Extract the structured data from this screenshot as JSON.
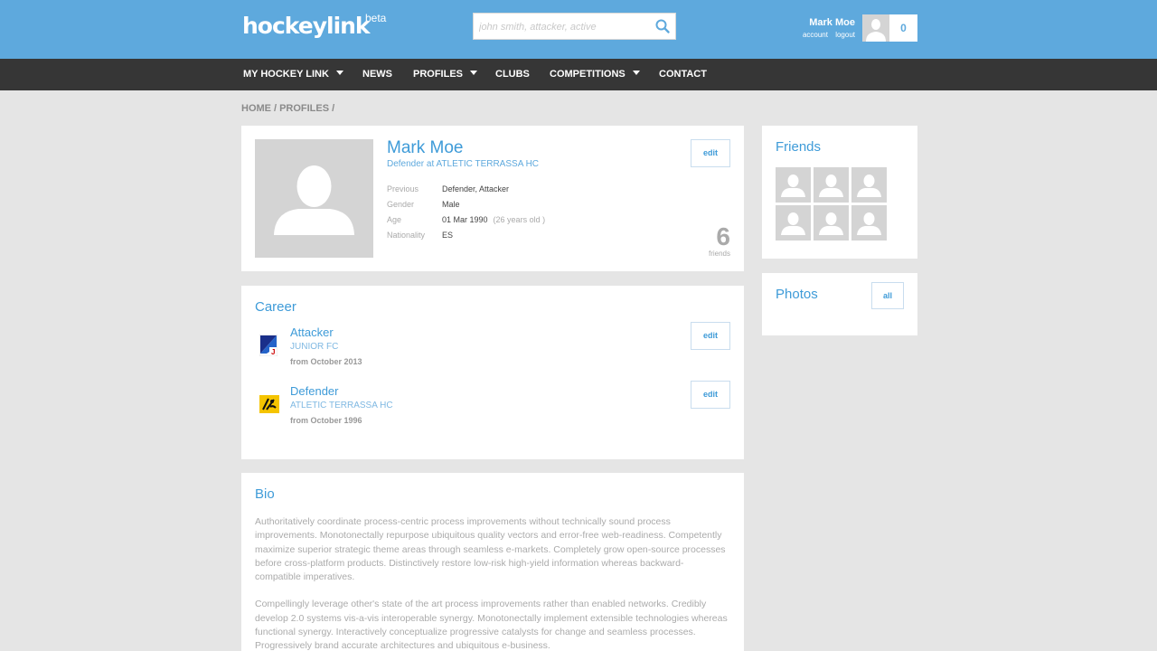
{
  "header": {
    "logo": "hockeylink",
    "logo_badge": "beta",
    "search_placeholder": "john smith, attacker, active",
    "user_name": "Mark Moe",
    "account_link": "account",
    "logout_link": "logout",
    "notification_count": "0"
  },
  "nav": {
    "items": [
      {
        "label": "MY HOCKEY LINK",
        "has_dropdown": true
      },
      {
        "label": "NEWS",
        "has_dropdown": false
      },
      {
        "label": "PROFILES",
        "has_dropdown": true
      },
      {
        "label": "CLUBS",
        "has_dropdown": false
      },
      {
        "label": "COMPETITIONS",
        "has_dropdown": true
      },
      {
        "label": "CONTACT",
        "has_dropdown": false
      }
    ]
  },
  "breadcrumb": {
    "items": [
      "HOME",
      "PROFILES"
    ],
    "separator": "/"
  },
  "profile": {
    "name": "Mark Moe",
    "position_line": "Defender at ATLETIC TERRASSA HC",
    "edit_label": "edit",
    "fields": [
      {
        "label": "Previous",
        "value": "Defender, Attacker",
        "extra": ""
      },
      {
        "label": "Gender",
        "value": "Male",
        "extra": ""
      },
      {
        "label": "Age",
        "value": "01 Mar 1990",
        "extra": "(26 years old )"
      },
      {
        "label": "Nationality",
        "value": "ES",
        "extra": ""
      }
    ],
    "friends_count": "6",
    "friends_label": "friends"
  },
  "career": {
    "title": "Career",
    "items": [
      {
        "role": "Attacker",
        "club": "JUNIOR FC",
        "from": "from October 2013",
        "edit_label": "edit"
      },
      {
        "role": "Defender",
        "club": "ATLETIC TERRASSA HC",
        "from": "from October 1996",
        "edit_label": "edit"
      }
    ]
  },
  "bio": {
    "title": "Bio",
    "paragraphs": [
      "Authoritatively coordinate process-centric process improvements without technically sound process improvements. Monotonectally repurpose ubiquitous quality vectors and error-free web-readiness. Competently maximize superior strategic theme areas through seamless e-markets. Completely grow open-source processes before cross-platform products. Distinctively restore low-risk high-yield information whereas backward-compatible imperatives.",
      "Compellingly leverage other's state of the art process improvements rather than enabled networks. Credibly develop 2.0 systems vis-a-vis interoperable synergy. Monotonectally implement extensible technologies whereas functional synergy. Interactively conceptualize progressive catalysts for change and seamless processes. Progressively brand accurate architectures and ubiquitous e-business."
    ]
  },
  "friends_panel": {
    "title": "Friends"
  },
  "photos_panel": {
    "title": "Photos",
    "all_label": "all"
  },
  "colors": {
    "header_bg": "#5ea9dd",
    "nav_bg": "#363636",
    "accent": "#3e9bd8",
    "page_bg": "#e5e5e5"
  }
}
